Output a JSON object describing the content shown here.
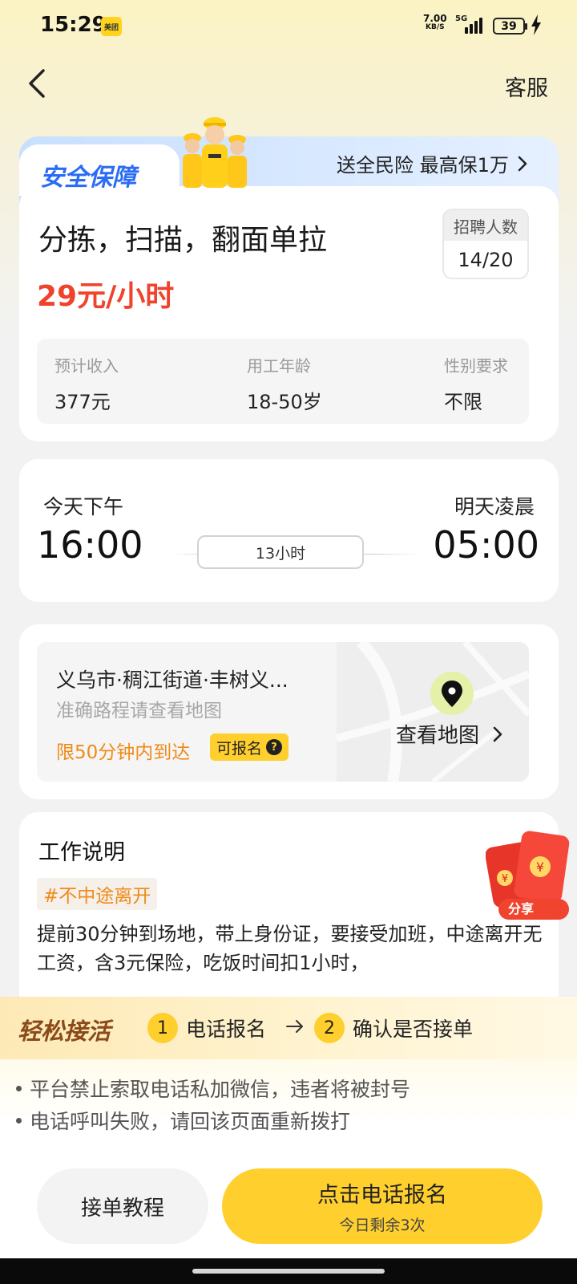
{
  "status_bar": {
    "time": "15:29",
    "app_badge": "美团",
    "net_speed": "7.00",
    "net_unit": "KB/S",
    "network": "5G",
    "battery": "39"
  },
  "header": {
    "service_label": "客服"
  },
  "safety": {
    "title": "安全保障",
    "insurance_text": "送全民险 最高保1万"
  },
  "job": {
    "title": "分拣，扫描，翻面单拉",
    "wage": "29元/小时",
    "recruit_label": "招聘人数",
    "recruit_value": "14/20",
    "info": [
      {
        "key": "预计收入",
        "value": "377元"
      },
      {
        "key": "用工年龄",
        "value": "18-50岁"
      },
      {
        "key": "性别要求",
        "value": "不限"
      }
    ]
  },
  "schedule": {
    "start_label": "今天下午",
    "start_time": "16:00",
    "duration": "13小时",
    "end_label": "明天凌晨",
    "end_time": "05:00"
  },
  "location": {
    "address": "义乌市·稠江街道·丰树义...",
    "hint": "准确路程请查看地图",
    "limit": "限50分钟内到达",
    "enroll_tag": "可报名",
    "map_link": "查看地图"
  },
  "description": {
    "title": "工作说明",
    "tag": "#不中途离开",
    "text": "提前30分钟到场地，带上身份证，要接受加班，中途离开无工资，含3元保险，吃饭时间扣1小时，"
  },
  "share": {
    "label": "分享"
  },
  "steps": {
    "title": "轻松接活",
    "step1_num": "1",
    "step1": "电话报名",
    "step2_num": "2",
    "step2": "确认是否接单"
  },
  "notices": [
    "平台禁止索取电话私加微信，违者将被封号",
    "电话呼叫失败，请回该页面重新拨打"
  ],
  "actions": {
    "tutorial": "接单教程",
    "call": "点击电话报名",
    "call_sub": "今日剩余3次"
  },
  "colors": {
    "accent_yellow": "#ffcf2e",
    "wage_red": "#f0432c",
    "limit_orange": "#f08a18",
    "safety_blue": "#2a6cf5"
  }
}
